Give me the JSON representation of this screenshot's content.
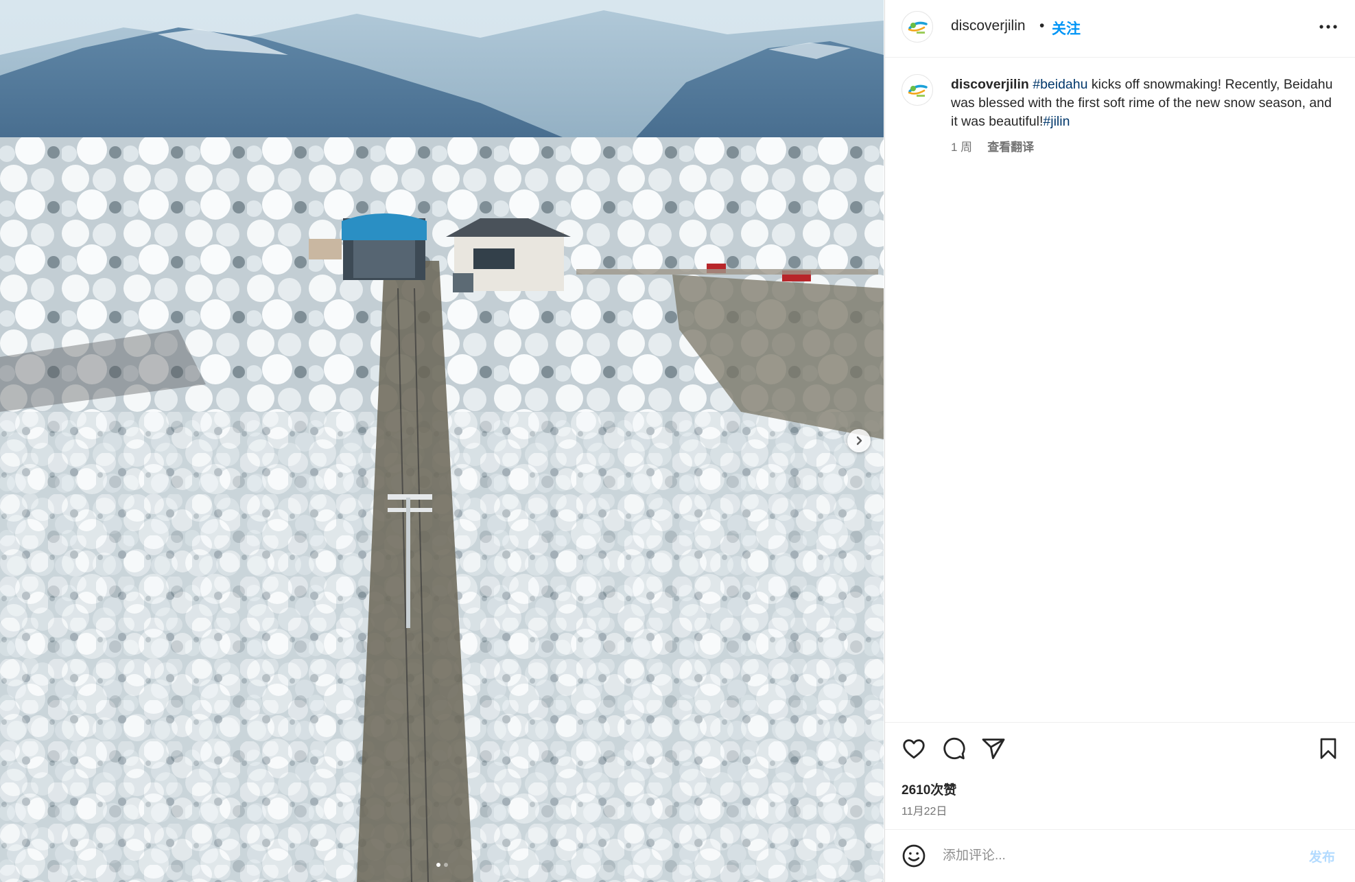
{
  "post": {
    "username": "discoverjilin",
    "separator": "•",
    "follow_label": "关注",
    "more_icon": "more-horizontal-icon"
  },
  "caption": {
    "username": "discoverjilin",
    "hashtag1": "#beidahu",
    "text": " kicks off snowmaking! Recently, Beidahu was blessed with the first soft rime of the new snow season, and it was beautiful!",
    "hashtag2": "#jilin",
    "age": "1 周",
    "translate_label": "查看翻译"
  },
  "stats": {
    "likes": "2610次赞",
    "date": "11月22日"
  },
  "comment": {
    "placeholder": "添加评论...",
    "post_label": "发布"
  },
  "media": {
    "description": "aerial view of snow-frosted forest with a cable car line and mountain station",
    "carousel_total": 2,
    "carousel_index": 1
  },
  "icons": {
    "like": "heart-icon",
    "comment": "comment-icon",
    "share": "share-icon",
    "save": "bookmark-icon",
    "emoji": "emoji-icon",
    "next": "chevron-right-icon"
  },
  "colors": {
    "accent": "#0095f6",
    "hashtag": "#00376b",
    "muted": "#737373",
    "post_disabled": "#b3dbff"
  }
}
